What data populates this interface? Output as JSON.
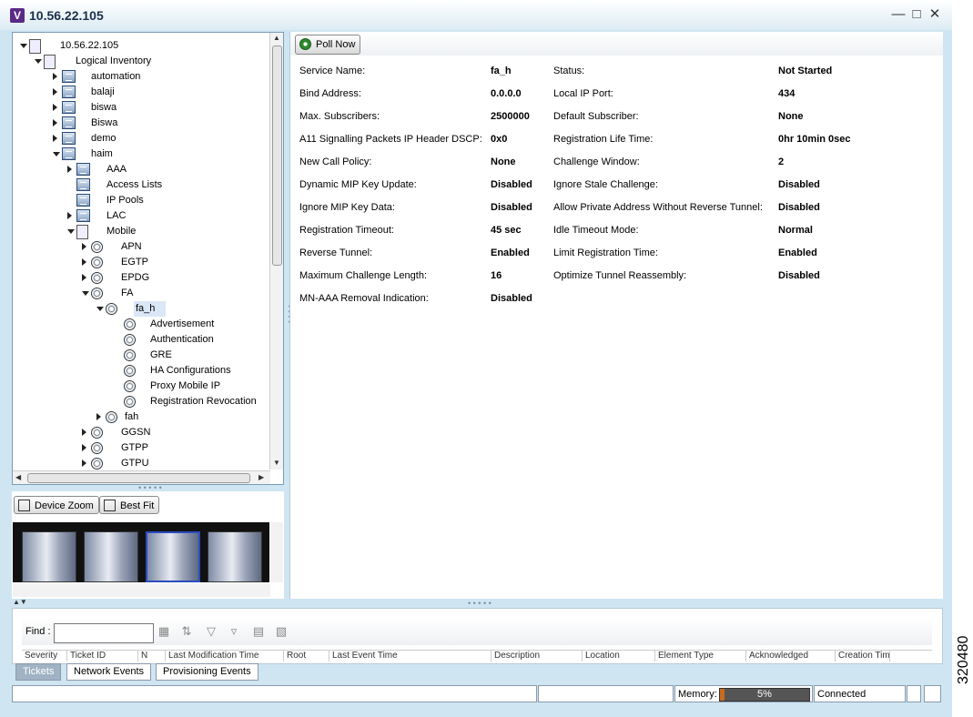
{
  "window": {
    "title": "10.56.22.105",
    "app_icon": "V",
    "controls": [
      "minimize-icon",
      "maximize-icon",
      "close-icon"
    ]
  },
  "tree": {
    "items": [
      {
        "label": "10.56.22.105",
        "icon": "device-icon",
        "expander": "open"
      },
      {
        "label": "Logical Inventory",
        "icon": "inventory-icon",
        "expander": "open"
      },
      {
        "label": "automation",
        "icon": "folder-icon",
        "expander": "closed"
      },
      {
        "label": "balaji",
        "icon": "folder-icon",
        "expander": "closed"
      },
      {
        "label": "biswa",
        "icon": "folder-icon",
        "expander": "closed"
      },
      {
        "label": "Biswa",
        "icon": "folder-icon",
        "expander": "closed"
      },
      {
        "label": "demo",
        "icon": "folder-icon",
        "expander": "closed"
      },
      {
        "label": "haim",
        "icon": "folder-icon",
        "expander": "open"
      },
      {
        "label": "AAA",
        "icon": "folder-icon",
        "expander": "closed"
      },
      {
        "label": "Access Lists",
        "icon": "folder-icon",
        "expander": "none"
      },
      {
        "label": "IP Pools",
        "icon": "folder-icon",
        "expander": "none"
      },
      {
        "label": "LAC",
        "icon": "folder-icon",
        "expander": "closed"
      },
      {
        "label": "Mobile",
        "icon": "antenna-icon",
        "expander": "open"
      },
      {
        "label": "APN",
        "icon": "gear-icon",
        "expander": "closed"
      },
      {
        "label": "EGTP",
        "icon": "gear-icon",
        "expander": "closed"
      },
      {
        "label": "EPDG",
        "icon": "gear-icon",
        "expander": "closed"
      },
      {
        "label": "FA",
        "icon": "gear-icon",
        "expander": "open"
      },
      {
        "label": "fa_h",
        "icon": "gear-icon",
        "expander": "open",
        "selected": true
      },
      {
        "label": "Advertisement",
        "icon": "gear-icon",
        "expander": "none"
      },
      {
        "label": "Authentication",
        "icon": "gear-icon",
        "expander": "none"
      },
      {
        "label": "GRE",
        "icon": "gear-icon",
        "expander": "none"
      },
      {
        "label": "HA Configurations",
        "icon": "gear-icon",
        "expander": "none"
      },
      {
        "label": "Proxy Mobile IP",
        "icon": "gear-icon",
        "expander": "none"
      },
      {
        "label": "Registration Revocation",
        "icon": "gear-icon",
        "expander": "none"
      },
      {
        "label": "fah",
        "icon": "gear-icon",
        "expander": "closed"
      },
      {
        "label": "GGSN",
        "icon": "gear-icon",
        "expander": "closed"
      },
      {
        "label": "GTPP",
        "icon": "gear-icon",
        "expander": "closed"
      },
      {
        "label": "GTPU",
        "icon": "gear-icon",
        "expander": "closed"
      }
    ]
  },
  "zoom": {
    "device_zoom": "Device Zoom",
    "best_fit": "Best Fit"
  },
  "toolbar": {
    "poll_now": "Poll Now"
  },
  "properties": {
    "left": [
      {
        "label": "Service Name:",
        "value": "fa_h"
      },
      {
        "label": "Bind Address:",
        "value": "0.0.0.0"
      },
      {
        "label": "Max. Subscribers:",
        "value": "2500000"
      },
      {
        "label": "A11 Signalling Packets IP Header DSCP:",
        "value": "0x0"
      },
      {
        "label": "New Call Policy:",
        "value": "None"
      },
      {
        "label": "Dynamic MIP Key Update:",
        "value": "Disabled"
      },
      {
        "label": "Ignore MIP Key Data:",
        "value": "Disabled"
      },
      {
        "label": "Registration Timeout:",
        "value": "45 sec"
      },
      {
        "label": "Reverse Tunnel:",
        "value": "Enabled"
      },
      {
        "label": "Maximum Challenge Length:",
        "value": "16"
      },
      {
        "label": "MN-AAA Removal Indication:",
        "value": "Disabled"
      }
    ],
    "right": [
      {
        "label": "Status:",
        "value": "Not Started"
      },
      {
        "label": "Local IP Port:",
        "value": "434"
      },
      {
        "label": "Default Subscriber:",
        "value": "None"
      },
      {
        "label": "Registration Life Time:",
        "value": "0hr 10min 0sec"
      },
      {
        "label": "Challenge Window:",
        "value": "2"
      },
      {
        "label": "Ignore Stale Challenge:",
        "value": "Disabled"
      },
      {
        "label": "Allow Private Address Without Reverse Tunnel:",
        "value": "Disabled"
      },
      {
        "label": "Idle Timeout Mode:",
        "value": "Normal"
      },
      {
        "label": "Limit Registration Time:",
        "value": "Enabled"
      },
      {
        "label": "Optimize Tunnel Reassembly:",
        "value": "Disabled"
      }
    ]
  },
  "find": {
    "label": "Find :",
    "value": ""
  },
  "table_columns": [
    "Severity",
    "Ticket ID",
    "N",
    "Last Modification Time",
    "Root",
    "Last Event Time",
    "Description",
    "Location",
    "Element Type",
    "Acknowledged",
    "Creation Time"
  ],
  "tabs": [
    "Tickets",
    "Network Events",
    "Provisioning Events"
  ],
  "status": {
    "memory_label": "Memory:",
    "memory_percent": "5%",
    "memory_fraction": 0.05,
    "connection": "Connected"
  },
  "figure_number": "320480"
}
